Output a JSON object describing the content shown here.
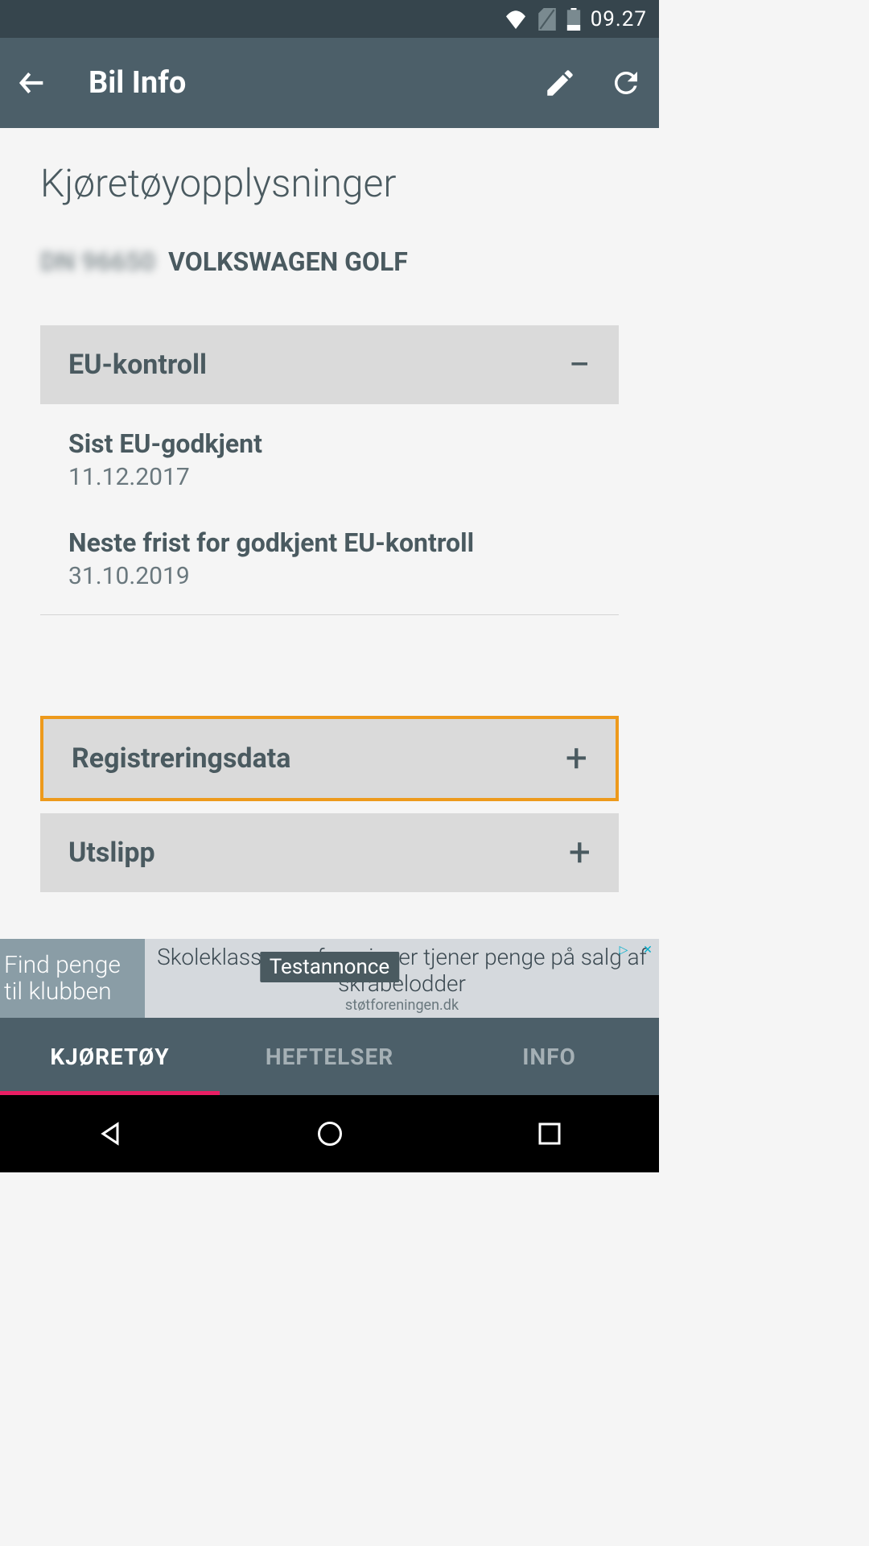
{
  "statusBar": {
    "time": "09.27"
  },
  "appBar": {
    "title": "Bil Info"
  },
  "page": {
    "title": "Kjøretøyopplysninger",
    "vehiclePrefix": "DN 96650",
    "vehicleName": "VOLKSWAGEN GOLF"
  },
  "accordions": {
    "euKontroll": {
      "title": "EU-kontroll",
      "expanded": true,
      "fields": [
        {
          "label": "Sist EU-godkjent",
          "value": "11.12.2017"
        },
        {
          "label": "Neste frist for godkjent EU-kontroll",
          "value": "31.10.2019"
        }
      ]
    },
    "registreringsdata": {
      "title": "Registreringsdata",
      "expanded": false
    },
    "utslipp": {
      "title": "Utslipp",
      "expanded": false
    }
  },
  "ad": {
    "leftText": "Find penge til klubben",
    "mainText": "Skoleklasser og foreninger tjener penge på salg af skrabelodder",
    "subText": "støtforeningen.dk",
    "label": "Testannonce"
  },
  "tabs": [
    {
      "label": "KJØRETØY",
      "active": true
    },
    {
      "label": "HEFTELSER",
      "active": false
    },
    {
      "label": "INFO",
      "active": false
    }
  ]
}
